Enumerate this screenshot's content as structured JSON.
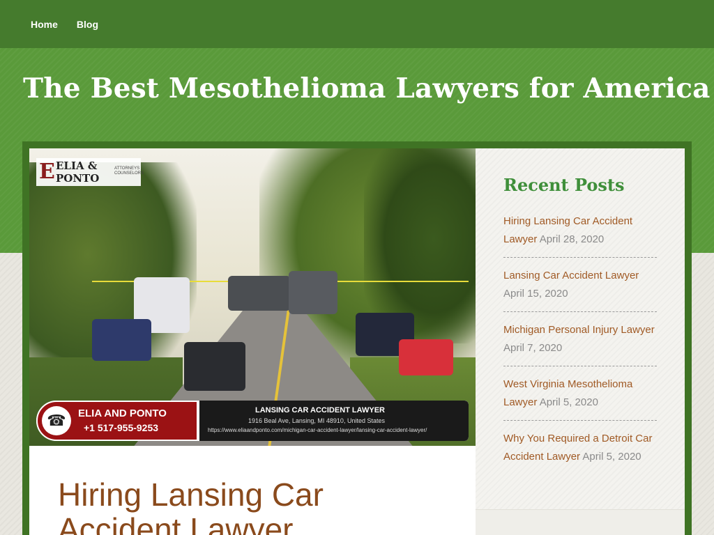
{
  "nav": {
    "items": [
      {
        "label": "Home"
      },
      {
        "label": "Blog"
      }
    ]
  },
  "site": {
    "title": "The Best Mesothelioma Lawyers for America"
  },
  "post": {
    "title": "Hiring Lansing Car Accident Lawyer",
    "featured_image": {
      "logo": {
        "initial": "E",
        "line1": "ELIA &",
        "line2": "PONTO",
        "sub": "ATTORNEYS COUNSELORS"
      },
      "banner": {
        "name": "ELIA AND PONTO",
        "phone": "+1 517-955-9253",
        "heading": "LANSING CAR ACCIDENT LAWYER",
        "address": "1916 Beal Ave, Lansing, MI 48910, United States",
        "url": "https://www.eliaandponto.com/michigan-car-accident-lawyer/lansing-car-accident-lawyer/"
      }
    }
  },
  "sidebar": {
    "widget_title": "Recent Posts",
    "recent_posts": [
      {
        "title": "Hiring Lansing Car Accident Lawyer",
        "date": "April 28, 2020"
      },
      {
        "title": "Lansing Car Accident Lawyer",
        "date": "April 15, 2020"
      },
      {
        "title": "Michigan Personal Injury Lawyer",
        "date": "April 7, 2020"
      },
      {
        "title": "West Virginia Mesothelioma Lawyer",
        "date": "April 5, 2020"
      },
      {
        "title": "Why You Required a Detroit Car Accident Lawyer",
        "date": "April 5, 2020"
      }
    ]
  },
  "colors": {
    "nav_bg": "#457b2d",
    "header_bg": "#5a9a3a",
    "post_title": "#8a4a1c",
    "widget_title": "#3f8f3a",
    "link": "#a05a25"
  }
}
